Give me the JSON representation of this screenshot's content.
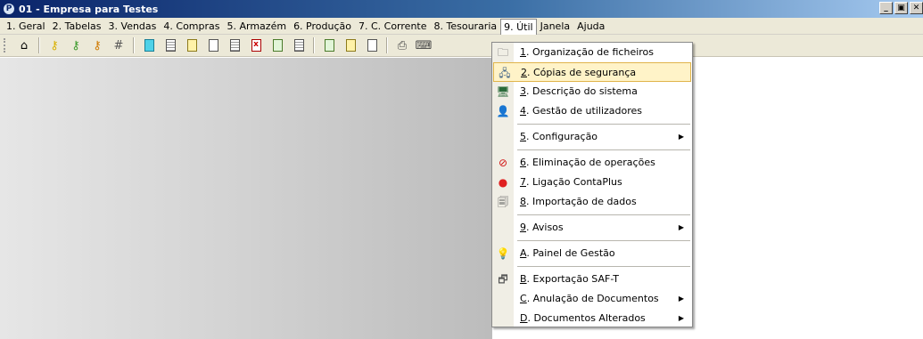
{
  "window": {
    "title": "01 - Empresa para Testes",
    "controls": [
      "_",
      "7",
      "X"
    ]
  },
  "menubar": {
    "items": [
      "1. Geral",
      "2. Tabelas",
      "3. Vendas",
      "4. Compras",
      "5. Armazém",
      "6. Produção",
      "7. C. Corrente",
      "8. Tesouraria",
      "9. Útil",
      "Janela",
      "Ajuda"
    ],
    "active_index": 8
  },
  "toolbar": {
    "icons": [
      "home-icon",
      "key-yellow-icon",
      "key-green-icon",
      "key-orange-icon",
      "grid-icon",
      "document-cyan-icon",
      "document-lines-icon",
      "document-yellow-icon",
      "document-blank-icon",
      "document-small-icon",
      "document-x-icon",
      "document-green-icon",
      "document-list-icon",
      "document-edit-icon",
      "document-add-icon",
      "document-multi-icon",
      "printer-icon",
      "keyboard-icon"
    ]
  },
  "dropdown": {
    "items": [
      {
        "key": "1",
        "rest": ". Organização de ficheiros",
        "icon": "folder-icon",
        "glyph": "🗀",
        "separator_after": false,
        "submenu": false,
        "highlight": false
      },
      {
        "key": "2",
        "rest": ". Cópias de segurança",
        "icon": "backup-icon",
        "glyph": "🖧",
        "separator_after": false,
        "submenu": false,
        "highlight": true
      },
      {
        "key": "3",
        "rest": ". Descrição do sistema",
        "icon": "system-description-icon",
        "glyph": "🖥",
        "separator_after": false,
        "submenu": false,
        "highlight": false
      },
      {
        "key": "4",
        "rest": ". Gestão de utilizadores",
        "icon": "users-icon",
        "glyph": "👤",
        "separator_after": true,
        "submenu": false,
        "highlight": false
      },
      {
        "key": "5",
        "rest": ". Configuração",
        "icon": "",
        "glyph": "",
        "separator_after": true,
        "submenu": true,
        "highlight": false
      },
      {
        "key": "6",
        "rest": ". Eliminação de operações",
        "icon": "delete-operations-icon",
        "glyph": "⊘",
        "separator_after": false,
        "submenu": false,
        "highlight": false
      },
      {
        "key": "7",
        "rest": ". Ligação ContaPlus",
        "icon": "contaplus-icon",
        "glyph": "●",
        "separator_after": false,
        "submenu": false,
        "highlight": false
      },
      {
        "key": "8",
        "rest": ". Importação de dados",
        "icon": "import-data-icon",
        "glyph": "🗐",
        "separator_after": true,
        "submenu": false,
        "highlight": false
      },
      {
        "key": "9",
        "rest": ". Avisos",
        "icon": "",
        "glyph": "",
        "separator_after": true,
        "submenu": true,
        "highlight": false
      },
      {
        "key": "A",
        "rest": ". Painel de Gestão",
        "icon": "lightbulb-icon",
        "glyph": "💡",
        "separator_after": true,
        "submenu": false,
        "highlight": false
      },
      {
        "key": "B",
        "rest": ". Exportação SAF-T",
        "icon": "export-saft-icon",
        "glyph": "🗗",
        "separator_after": false,
        "submenu": false,
        "highlight": false
      },
      {
        "key": "C",
        "rest": ". Anulação de Documentos",
        "icon": "",
        "glyph": "",
        "separator_after": false,
        "submenu": true,
        "highlight": false
      },
      {
        "key": "D",
        "rest": ". Documentos Alterados",
        "icon": "",
        "glyph": "",
        "separator_after": false,
        "submenu": true,
        "highlight": false
      }
    ],
    "submenu_arrow": "▶"
  }
}
